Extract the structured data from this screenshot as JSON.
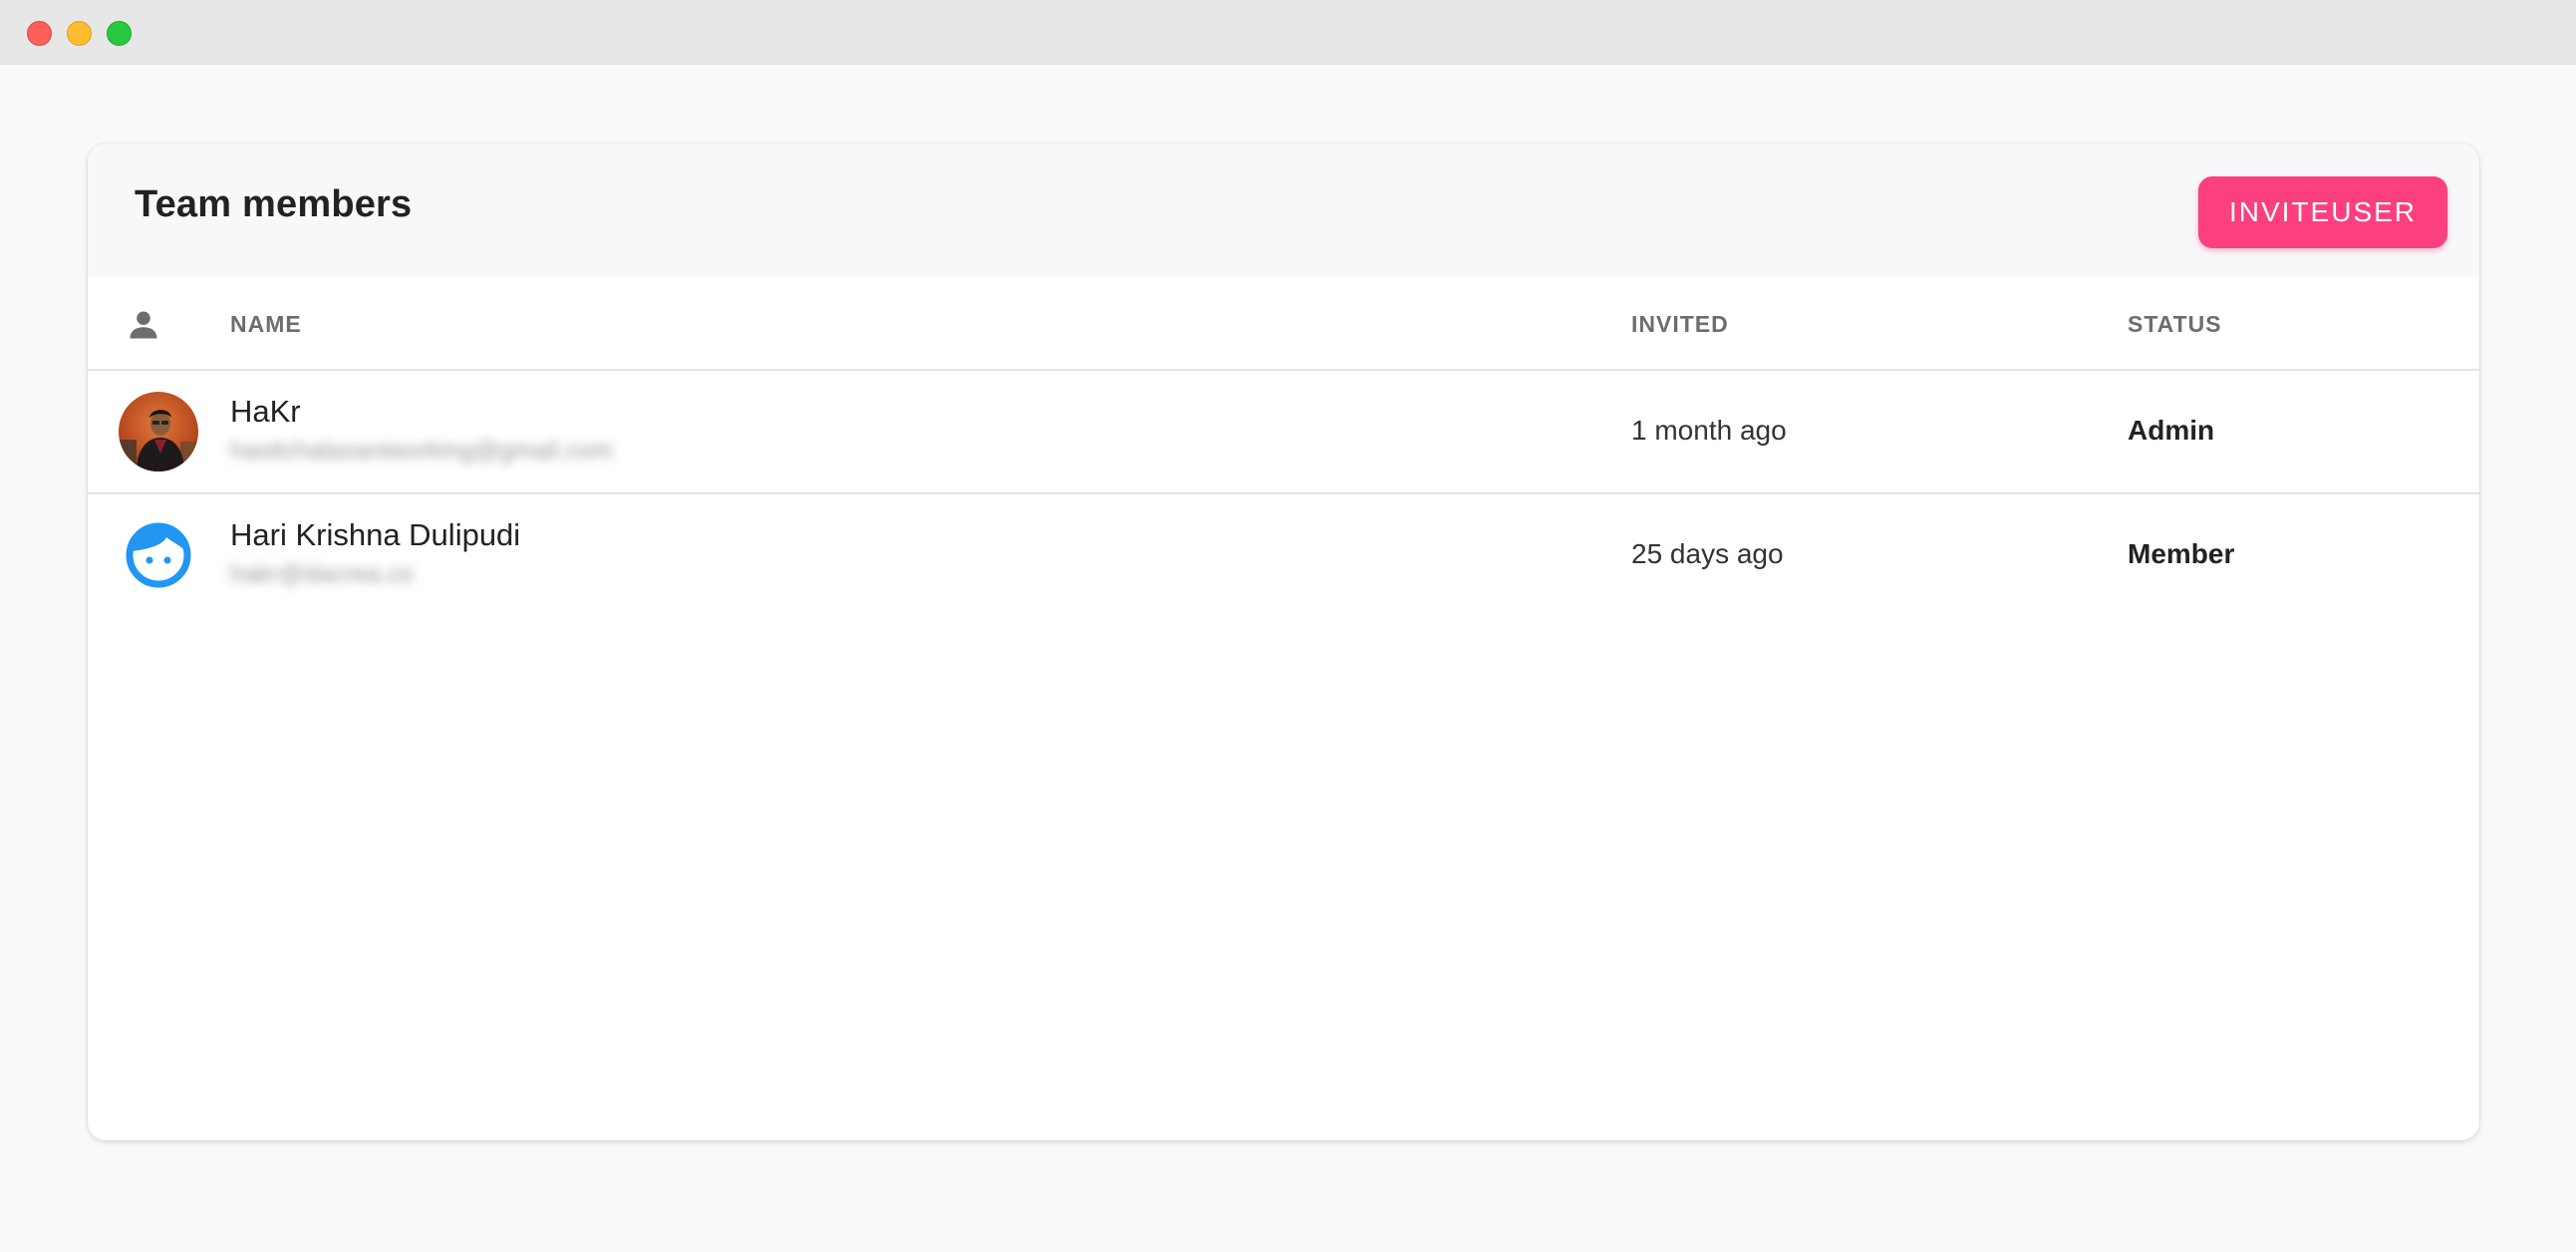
{
  "window": {
    "controls": [
      "close",
      "minimize",
      "maximize"
    ]
  },
  "card": {
    "title": "Team members",
    "invite_button_label": "INVITEUSER"
  },
  "table": {
    "header_icon": "person-icon",
    "columns": {
      "name": "NAME",
      "invited": "INVITED",
      "status": "STATUS"
    },
    "rows": [
      {
        "avatar": "user-photo",
        "name": "HaKr",
        "email": "hasitchalasaniworking@gmail.com",
        "invited": "1 month ago",
        "status": "Admin"
      },
      {
        "avatar": "face-icon",
        "name": "Hari Krishna Dulipudi",
        "email": "hakr@dacrea.co",
        "invited": "25 days ago",
        "status": "Member"
      }
    ]
  },
  "colors": {
    "accent": "#fc3f7e",
    "avatar_blue": "#2196f3"
  }
}
